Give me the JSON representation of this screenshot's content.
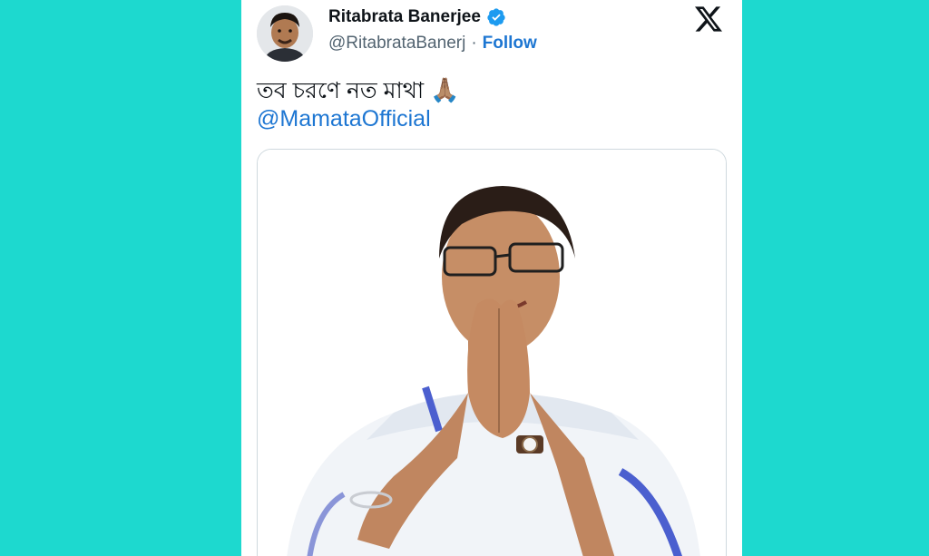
{
  "tweet": {
    "author": {
      "display_name": "Ritabrata Banerjee",
      "handle": "@RitabrataBanerj",
      "separator": "·",
      "follow_label": "Follow",
      "verified": true
    },
    "text": "তব চরণে নত মাথা",
    "emoji": "🙏🏽",
    "mention": "@MamataOfficial",
    "brand_icon": "x-logo-icon"
  },
  "colors": {
    "background": "#1dd9cf",
    "card": "#ffffff",
    "link": "#1d76d2",
    "verified": "#1d9bf0",
    "handle": "#536471"
  }
}
